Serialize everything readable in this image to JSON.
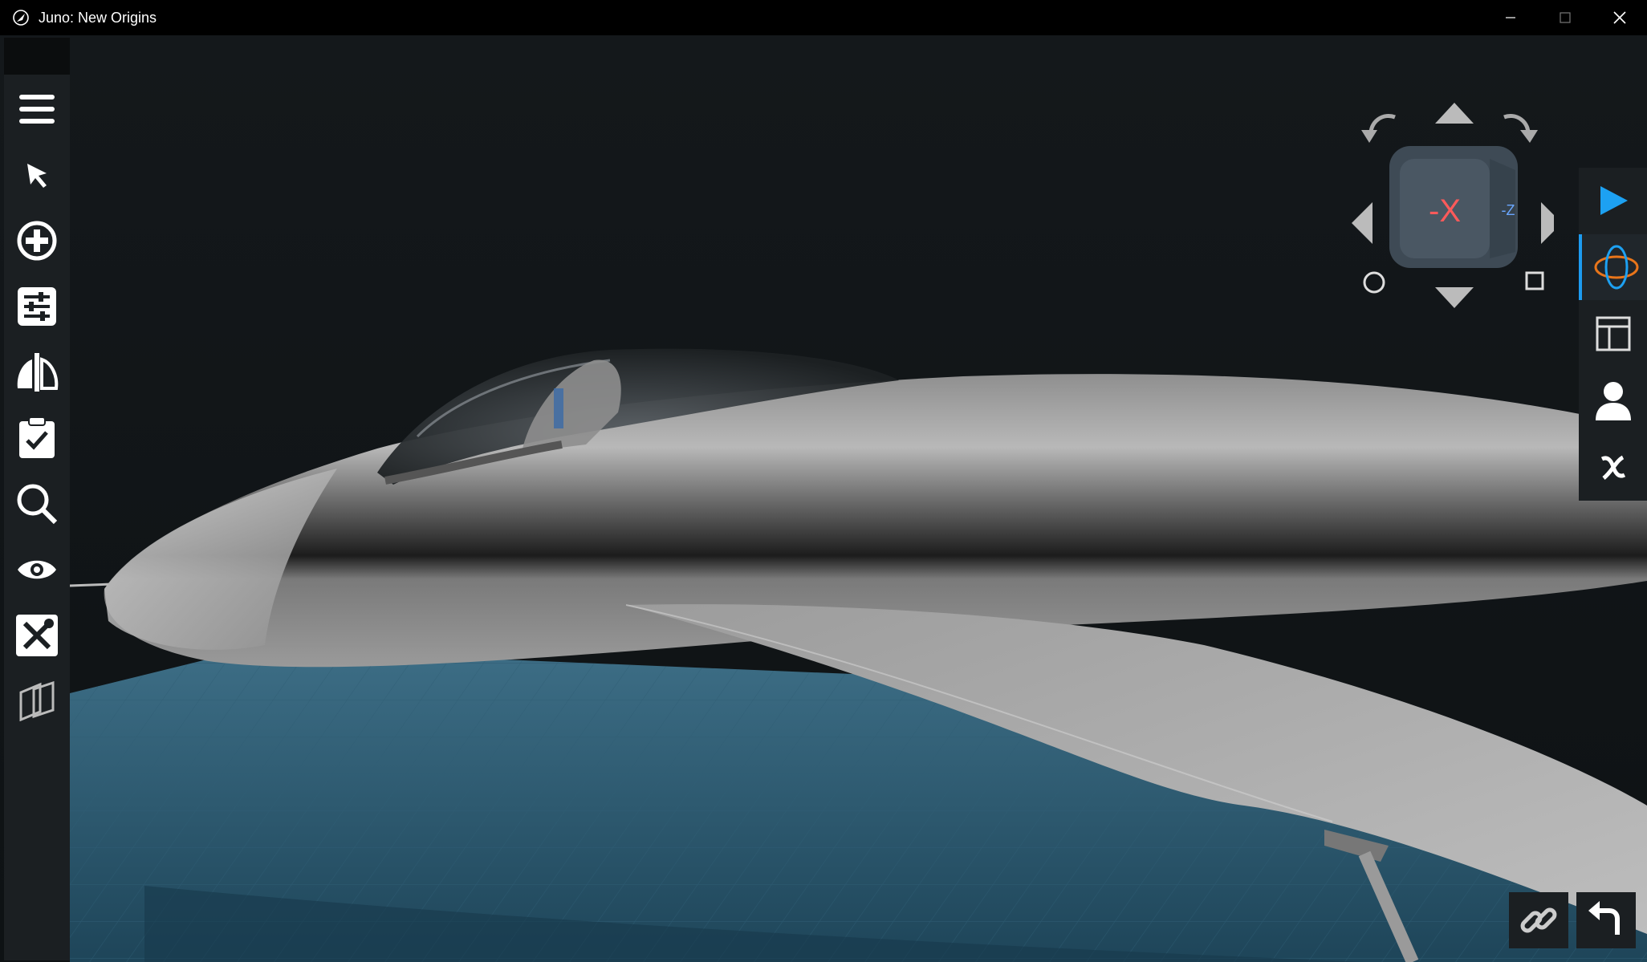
{
  "window": {
    "title": "Juno: New Origins"
  },
  "titlebar": {
    "icons": [
      "app-icon",
      "minimize-icon",
      "maximize-icon",
      "close-icon"
    ]
  },
  "left_toolbar": {
    "tools": [
      {
        "name": "menu",
        "icon": "hamburger-menu-icon"
      },
      {
        "name": "select",
        "icon": "cursor-arrow-icon"
      },
      {
        "name": "add-part",
        "icon": "plus-circle-icon"
      },
      {
        "name": "properties",
        "icon": "sliders-icon"
      },
      {
        "name": "symmetry",
        "icon": "symmetry-icon"
      },
      {
        "name": "checklist",
        "icon": "clipboard-check-icon"
      },
      {
        "name": "search",
        "icon": "search-icon"
      },
      {
        "name": "view",
        "icon": "eye-icon"
      },
      {
        "name": "tools",
        "icon": "wrench-screwdriver-icon"
      },
      {
        "name": "views-panel",
        "icon": "layered-views-icon"
      }
    ]
  },
  "navcube": {
    "face_label": "-X",
    "side_label": "-Z"
  },
  "right_toolbar": {
    "tools": [
      {
        "name": "launch",
        "icon": "play-icon",
        "color": "#1da1f2"
      },
      {
        "name": "orbit",
        "icon": "orbit-icon",
        "active": true
      },
      {
        "name": "layout",
        "icon": "layout-panel-icon"
      },
      {
        "name": "crew",
        "icon": "person-icon"
      },
      {
        "name": "variables",
        "icon": "variable-x-icon"
      }
    ]
  },
  "bottom_right": {
    "icons": [
      "link-icon",
      "undo-icon"
    ]
  },
  "colors": {
    "accent": "#1da1f2",
    "orbit_orange": "#e8751a",
    "navcube_red": "#ff5a5a",
    "ground": "#27566f"
  }
}
